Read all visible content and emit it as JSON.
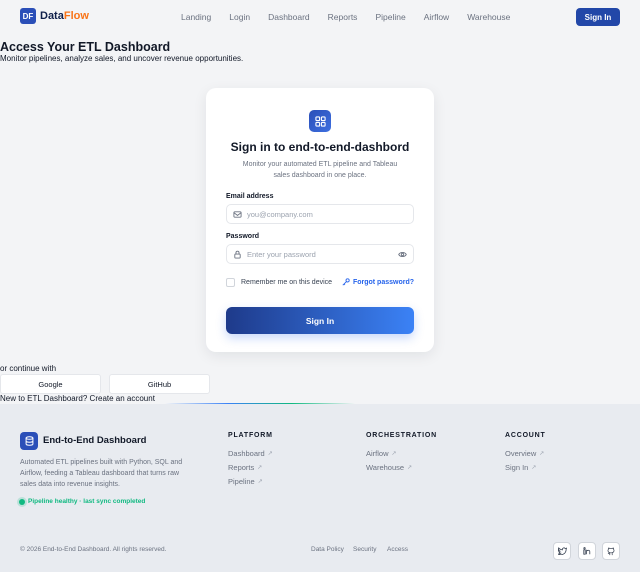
{
  "header": {
    "logo_badge": "DF",
    "brand_main": "Data",
    "brand_accent": "Flow",
    "nav": [
      "Landing",
      "Login",
      "Dashboard",
      "Reports",
      "Pipeline",
      "Airflow",
      "Warehouse"
    ],
    "signin_label": "Sign In"
  },
  "hero": {
    "title": "Access Your ETL Dashboard",
    "subtitle": "Monitor pipelines, analyze sales, and uncover revenue opportunities."
  },
  "card": {
    "icon": "grid-icon",
    "title": "Sign in to end-to-end-dashbord",
    "subtitle": "Monitor your automated ETL pipeline and Tableau sales dashboard in one place.",
    "email_label": "Email address",
    "email_placeholder": "you@company.com",
    "password_label": "Password",
    "password_placeholder": "Enter your password",
    "remember_label": "Remember me on this device",
    "forgot_label": "Forgot password?",
    "submit_label": "Sign In"
  },
  "alt": {
    "or_text": "or continue with",
    "google": "Google",
    "github": "GitHub",
    "new_text": "New to ETL Dashboard?",
    "create_link": "Create an account"
  },
  "footer": {
    "brand": "End-to-End Dashboard",
    "description": "Automated ETL pipelines built with Python, SQL and Airflow, feeding a Tableau dashboard that turns raw sales data into revenue insights.",
    "status": "Pipeline healthy · last sync completed",
    "columns": [
      {
        "heading": "PLATFORM",
        "links": [
          "Dashboard",
          "Reports",
          "Pipeline"
        ]
      },
      {
        "heading": "ORCHESTRATION",
        "links": [
          "Airflow",
          "Warehouse"
        ]
      },
      {
        "heading": "ACCOUNT",
        "links": [
          "Overview",
          "Sign In"
        ]
      }
    ],
    "copyright": "© 2026 End-to-End Dashboard. All rights reserved.",
    "legal": [
      "Data Policy",
      "Security",
      "Access"
    ],
    "social_icons": [
      "twitter-icon",
      "linkedin-icon",
      "github-icon"
    ]
  },
  "colors": {
    "primary": "#2247a8",
    "accent": "#f97316",
    "success": "#10b981",
    "link": "#2563eb"
  }
}
